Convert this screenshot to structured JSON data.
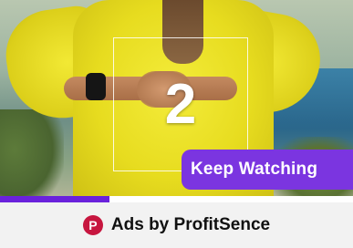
{
  "video": {
    "countdown": "2",
    "progress_fraction": 0.31
  },
  "keep_watching": {
    "label": "Keep Watching"
  },
  "footer": {
    "logo_letter": "P",
    "text": "Ads by ProfitSence"
  },
  "colors": {
    "accent": "#7b35e0",
    "progress": "#6a22dc",
    "logo": "#c7163f"
  },
  "icons": {
    "brand": "profitsence-logo-icon"
  }
}
